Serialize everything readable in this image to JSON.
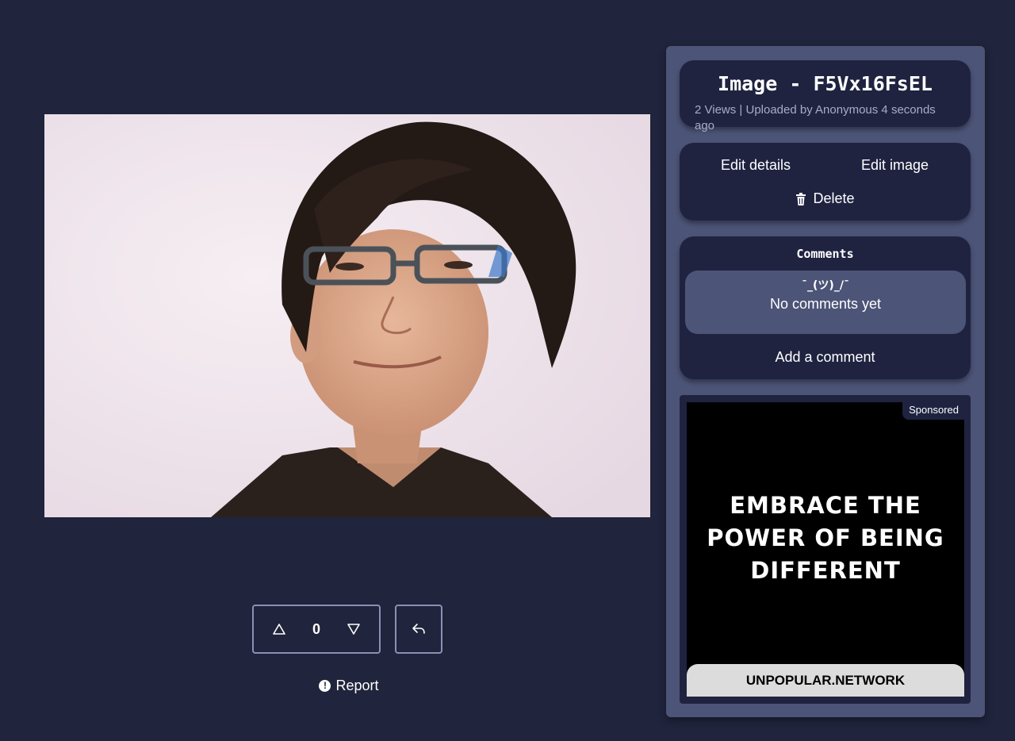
{
  "image": {
    "title": "Image - F5Vx16FsEL",
    "meta": "2 Views | Uploaded by Anonymous 4 seconds ago"
  },
  "actions": {
    "edit_details": "Edit details",
    "edit_image": "Edit image",
    "delete": "Delete"
  },
  "comments": {
    "title": "Comments",
    "shrug": "¯_(ツ)_/¯",
    "empty": "No comments yet",
    "add": "Add a comment"
  },
  "votes": {
    "count": "0"
  },
  "report": "Report",
  "ad": {
    "sponsored": "Sponsored",
    "headline_lines": [
      "EMBRACE THE",
      "POWER OF BEING",
      "DIFFERENT"
    ],
    "site": "UNPOPULAR.NETWORK"
  },
  "icons": {
    "upvote": "triangle-up-icon",
    "downvote": "triangle-down-icon",
    "share": "reply-arrow-icon",
    "report": "exclamation-circle-icon",
    "delete": "trash-icon"
  },
  "colors": {
    "background": "#20243c",
    "sidebar": "#4c5477",
    "card": "#1f2340",
    "muted_text": "#a8acc8",
    "border": "#8b90b4"
  }
}
